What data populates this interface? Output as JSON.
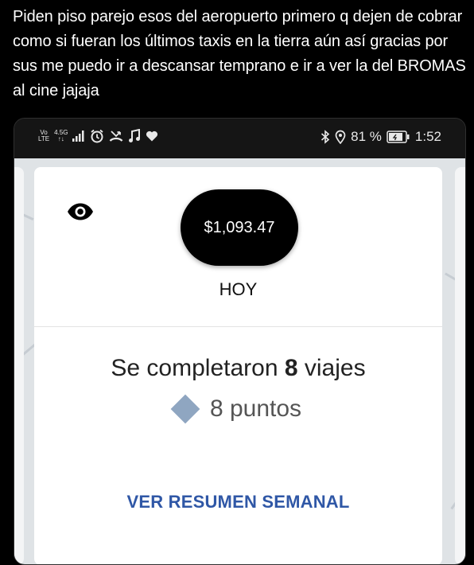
{
  "tweet": {
    "text": "Piden piso parejo esos del aeropuerto primero q dejen de cobrar como si fueran los últimos taxis en la tierra aún así gracias por sus me puedo ir a descansar temprano e ir a ver la del BROMAS al cine jajaja"
  },
  "status_bar": {
    "carrier_top": "Vo",
    "carrier_bottom": "LTE",
    "network_top": "4.5G",
    "network_bottom": "↑↓",
    "icons_left": [
      "signal-bars-icon",
      "alarm-clock-icon",
      "missed-call-icon",
      "music-note-icon",
      "heart-icon"
    ],
    "icons_right": [
      "bluetooth-icon",
      "location-pin-icon",
      "battery-icon"
    ],
    "battery_text": "81 %",
    "time": "1:52"
  },
  "earnings_card": {
    "balance": "$1,093.47",
    "period": "HOY",
    "trips_prefix": "Se completaron ",
    "trips_count": "8",
    "trips_suffix": " viajes",
    "points_text": "8 puntos",
    "weekly_link": "VER RESUMEN SEMANAL"
  },
  "colors": {
    "background": "#000000",
    "card": "#ffffff",
    "pill": "#000000",
    "link": "#2f57a6",
    "diamond": "#8fa6c1"
  }
}
